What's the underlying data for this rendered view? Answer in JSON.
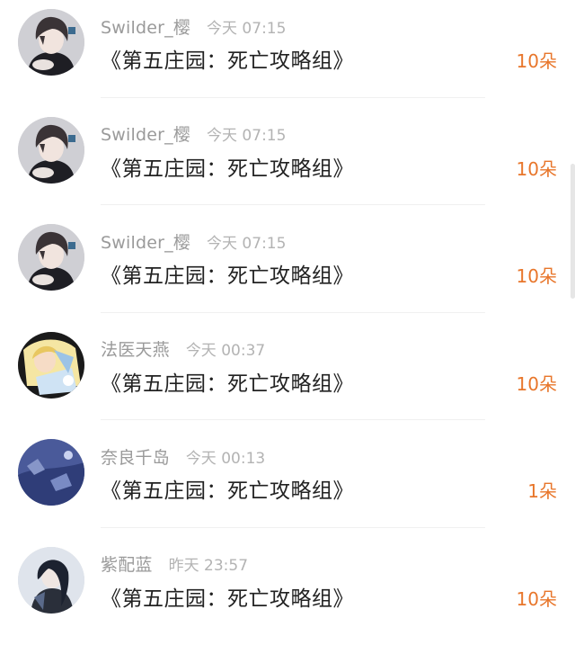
{
  "entries": [
    {
      "user": "Swilder_樱",
      "time": "今天 07:15",
      "title": "《第五庄园：死亡攻略组》",
      "gift": "10朵",
      "avatar": "dark-haired-boy-avatar"
    },
    {
      "user": "Swilder_樱",
      "time": "今天 07:15",
      "title": "《第五庄园：死亡攻略组》",
      "gift": "10朵",
      "avatar": "dark-haired-boy-avatar"
    },
    {
      "user": "Swilder_樱",
      "time": "今天 07:15",
      "title": "《第五庄园：死亡攻略组》",
      "gift": "10朵",
      "avatar": "dark-haired-boy-avatar"
    },
    {
      "user": "法医天燕",
      "time": "今天 00:37",
      "title": "《第五庄园：死亡攻略组》",
      "gift": "10朵",
      "avatar": "blonde-character-avatar"
    },
    {
      "user": "奈良千岛",
      "time": "今天 00:13",
      "title": "《第五庄园：死亡攻略组》",
      "gift": "1朵",
      "avatar": "blue-night-avatar"
    },
    {
      "user": "紫配蓝",
      "time": "昨天 23:57",
      "title": "《第五庄园：死亡攻略组》",
      "gift": "10朵",
      "avatar": "dark-character-avatar"
    }
  ],
  "colors": {
    "gift": "#e8762b",
    "name": "#9a9a9a",
    "time": "#b3b3b3",
    "title": "#222222"
  }
}
